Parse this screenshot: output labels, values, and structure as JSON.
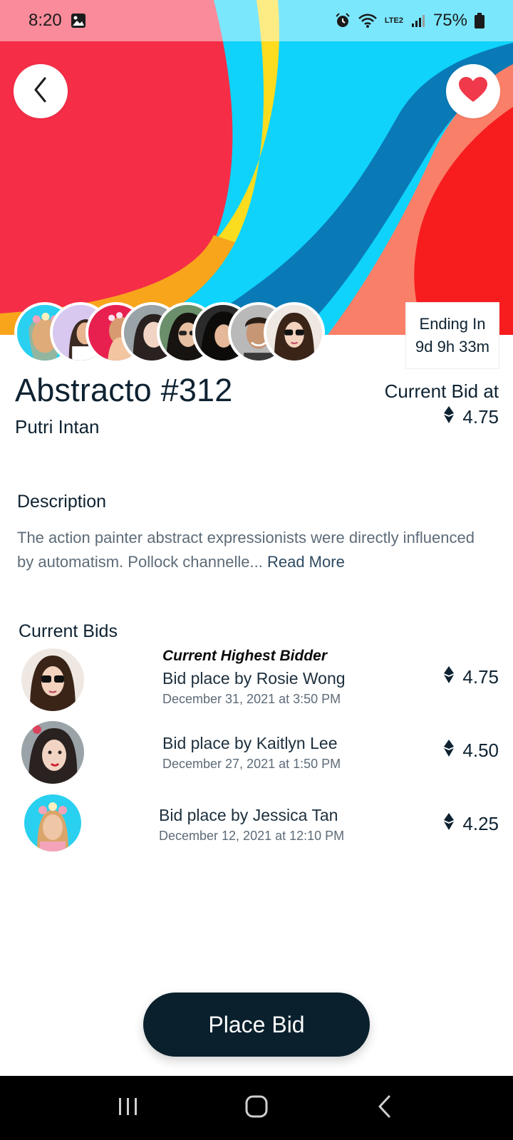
{
  "status_bar": {
    "time": "8:20",
    "battery": "75%",
    "network_label": "LTE2"
  },
  "colors": {
    "primary_dark": "#0a202d",
    "heart_red": "#f0394b",
    "text_dark": "#0e2231",
    "text_muted": "#5d6b78"
  },
  "icons": {
    "back": "chevron-left-icon",
    "favorite": "heart-icon",
    "currency": "ethereum-icon"
  },
  "ending": {
    "label": "Ending In",
    "value": "9d 9h 33m"
  },
  "artwork": {
    "title": "Abstracto #312",
    "artist": "Putri Intan",
    "current_bid_label": "Current Bid at",
    "current_bid_value": "4.75"
  },
  "description": {
    "heading": "Description",
    "text": "The action painter abstract expressionists were directly influenced by automatism. Pollock channelle...",
    "read_more": "Read More"
  },
  "bids": {
    "heading": "Current Bids",
    "highest_label": "Current Highest Bidder",
    "items": [
      {
        "name": "Bid place by Rosie Wong",
        "date": "December 31, 2021 at 3:50 PM",
        "amount": "4.75"
      },
      {
        "name": "Bid place by Kaitlyn Lee",
        "date": "December 27, 2021 at 1:50 PM",
        "amount": "4.50"
      },
      {
        "name": "Bid place by Jessica Tan",
        "date": "December 12, 2021 at 12:10 PM",
        "amount": "4.25"
      }
    ]
  },
  "actions": {
    "place_bid": "Place Bid"
  }
}
